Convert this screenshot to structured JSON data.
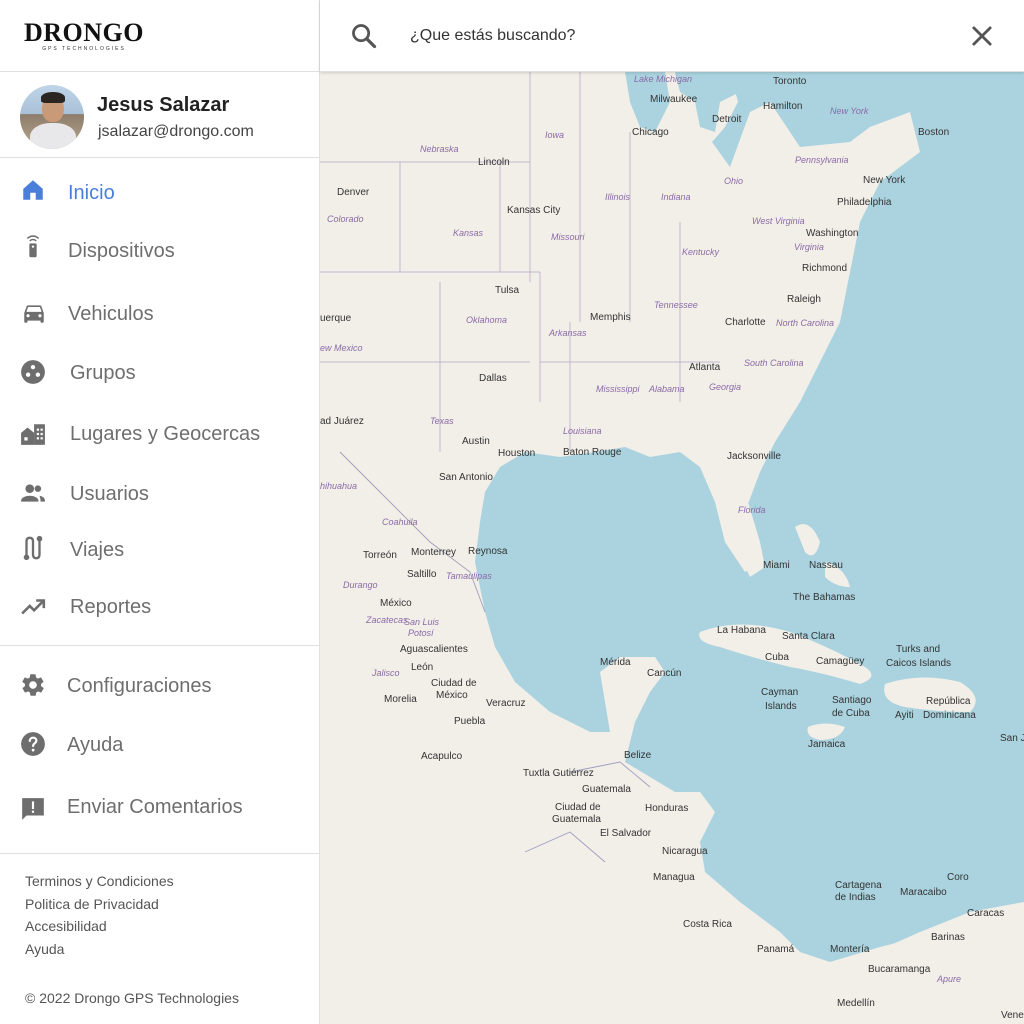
{
  "brand": {
    "name": "DRONGO",
    "tagline": "GPS TECHNOLOGIES"
  },
  "user": {
    "name": "Jesus Salazar",
    "email": "jsalazar@drongo.com"
  },
  "nav": {
    "primary": [
      {
        "label": "Inicio",
        "icon": "home-icon",
        "active": true
      },
      {
        "label": "Dispositivos",
        "icon": "device-icon"
      },
      {
        "label": "Vehiculos",
        "icon": "car-icon"
      },
      {
        "label": "Grupos",
        "icon": "groups-icon"
      },
      {
        "label": "Lugares y Geocercas",
        "icon": "places-icon"
      },
      {
        "label": "Usuarios",
        "icon": "users-icon"
      },
      {
        "label": "Viajes",
        "icon": "route-icon"
      },
      {
        "label": "Reportes",
        "icon": "trending-up-icon"
      }
    ],
    "secondary": [
      {
        "label": "Configuraciones",
        "icon": "gear-icon"
      },
      {
        "label": "Ayuda",
        "icon": "help-icon"
      },
      {
        "label": "Enviar Comentarios",
        "icon": "feedback-icon"
      }
    ]
  },
  "footer": {
    "links": [
      "Terminos y Condiciones",
      "Politica de Privacidad",
      "Accesibilidad",
      "Ayuda"
    ],
    "copyright": "© 2022 Drongo GPS Technologies"
  },
  "search": {
    "placeholder": "¿Que estás buscando?"
  },
  "colors": {
    "accent": "#4a7fd9",
    "icon": "#6e6e6e",
    "water": "#aad3df",
    "land": "#f2efe9"
  },
  "map": {
    "cities": [
      "Milwaukee",
      "Chicago",
      "Detroit",
      "Toronto",
      "Hamilton",
      "Boston",
      "New York",
      "Philadelphia",
      "Washington",
      "Richmond",
      "Raleigh",
      "Charlotte",
      "Lincoln",
      "Denver",
      "Kansas City",
      "Tulsa",
      "Memphis",
      "Atlanta",
      "Dallas",
      "Austin",
      "Houston",
      "San Antonio",
      "Baton Rouge",
      "Jacksonville",
      "Miami",
      "Nassau",
      "The Bahamas",
      "Monterrey",
      "Reynosa",
      "Torreón",
      "Saltillo",
      "México",
      "Aguascalientes",
      "León",
      "Ciudad de México",
      "Morelia",
      "Puebla",
      "Veracruz",
      "Acapulco",
      "Mérida",
      "Cancún",
      "La Habana",
      "Santa Clara",
      "Cuba",
      "Camagüey",
      "Cayman Islands",
      "Santiago de Cuba",
      "Jamaica",
      "Turks and Caicos Islands",
      "República Dominicana",
      "Ayiti",
      "Belize",
      "Tuxtla Gutiérrez",
      "Guatemala",
      "Ciudad de Guatemala",
      "Honduras",
      "El Salvador",
      "Nicaragua",
      "Managua",
      "Costa Rica",
      "Panamá",
      "Cartagena de Indias",
      "Maracaibo",
      "Coro",
      "Caracas",
      "Barinas",
      "Montería",
      "Bucaramanga",
      "Medellín",
      "San Juan",
      "Juárez",
      "uerque",
      "Apure",
      "Vene"
    ],
    "states": [
      "Lake Michigan",
      "New York",
      "Pennsylvania",
      "Ohio",
      "Indiana",
      "Illinois",
      "Iowa",
      "Nebraska",
      "Kansas",
      "Missouri",
      "Colorado",
      "Kentucky",
      "West Virginia",
      "Virginia",
      "Tennessee",
      "North Carolina",
      "Oklahoma",
      "Arkansas",
      "South Carolina",
      "Mississippi",
      "Alabama",
      "Georgia",
      "Louisiana",
      "Texas",
      "Florida",
      "ew Mexico",
      "hihuahua",
      "Coahuila",
      "Durango",
      "Tamaulipas",
      "Zacatecas",
      "San Luis Potosí",
      "Jalisco"
    ]
  }
}
